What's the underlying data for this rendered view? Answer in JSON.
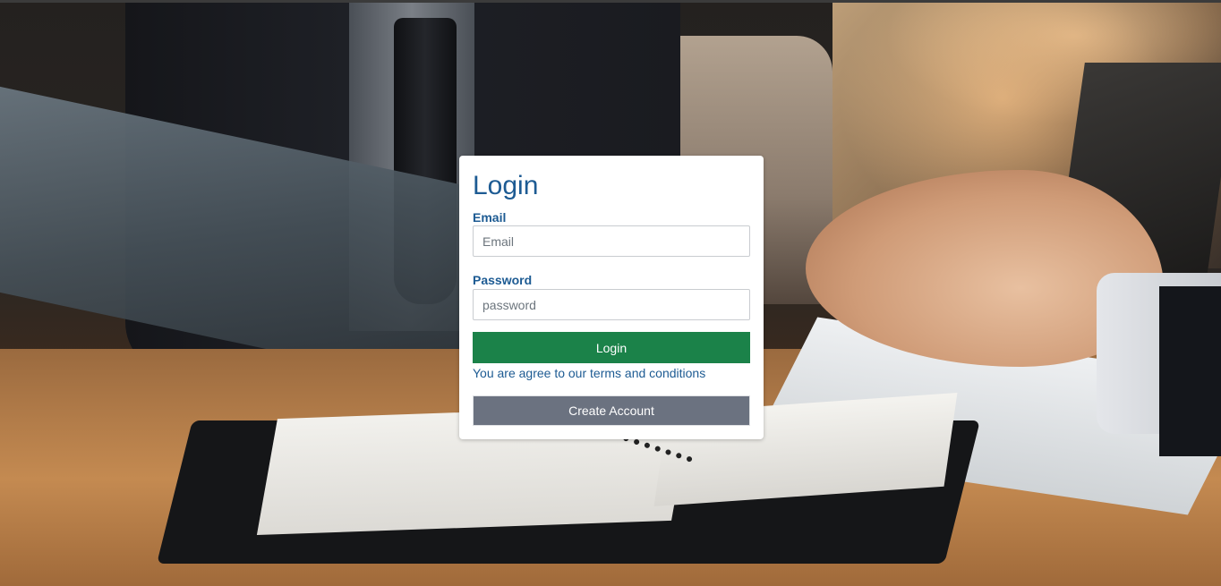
{
  "login_card": {
    "title": "Login",
    "email_label": "Email",
    "email_placeholder": "Email",
    "email_value": "",
    "password_label": "Password",
    "password_placeholder": "password",
    "password_value": "",
    "login_button": "Login",
    "terms_text": "You are agree to our terms and conditions",
    "create_account_button": "Create Account"
  },
  "colors": {
    "title_blue": "#1d5b93",
    "login_green": "#1b8249",
    "create_gray": "#6b7280"
  }
}
